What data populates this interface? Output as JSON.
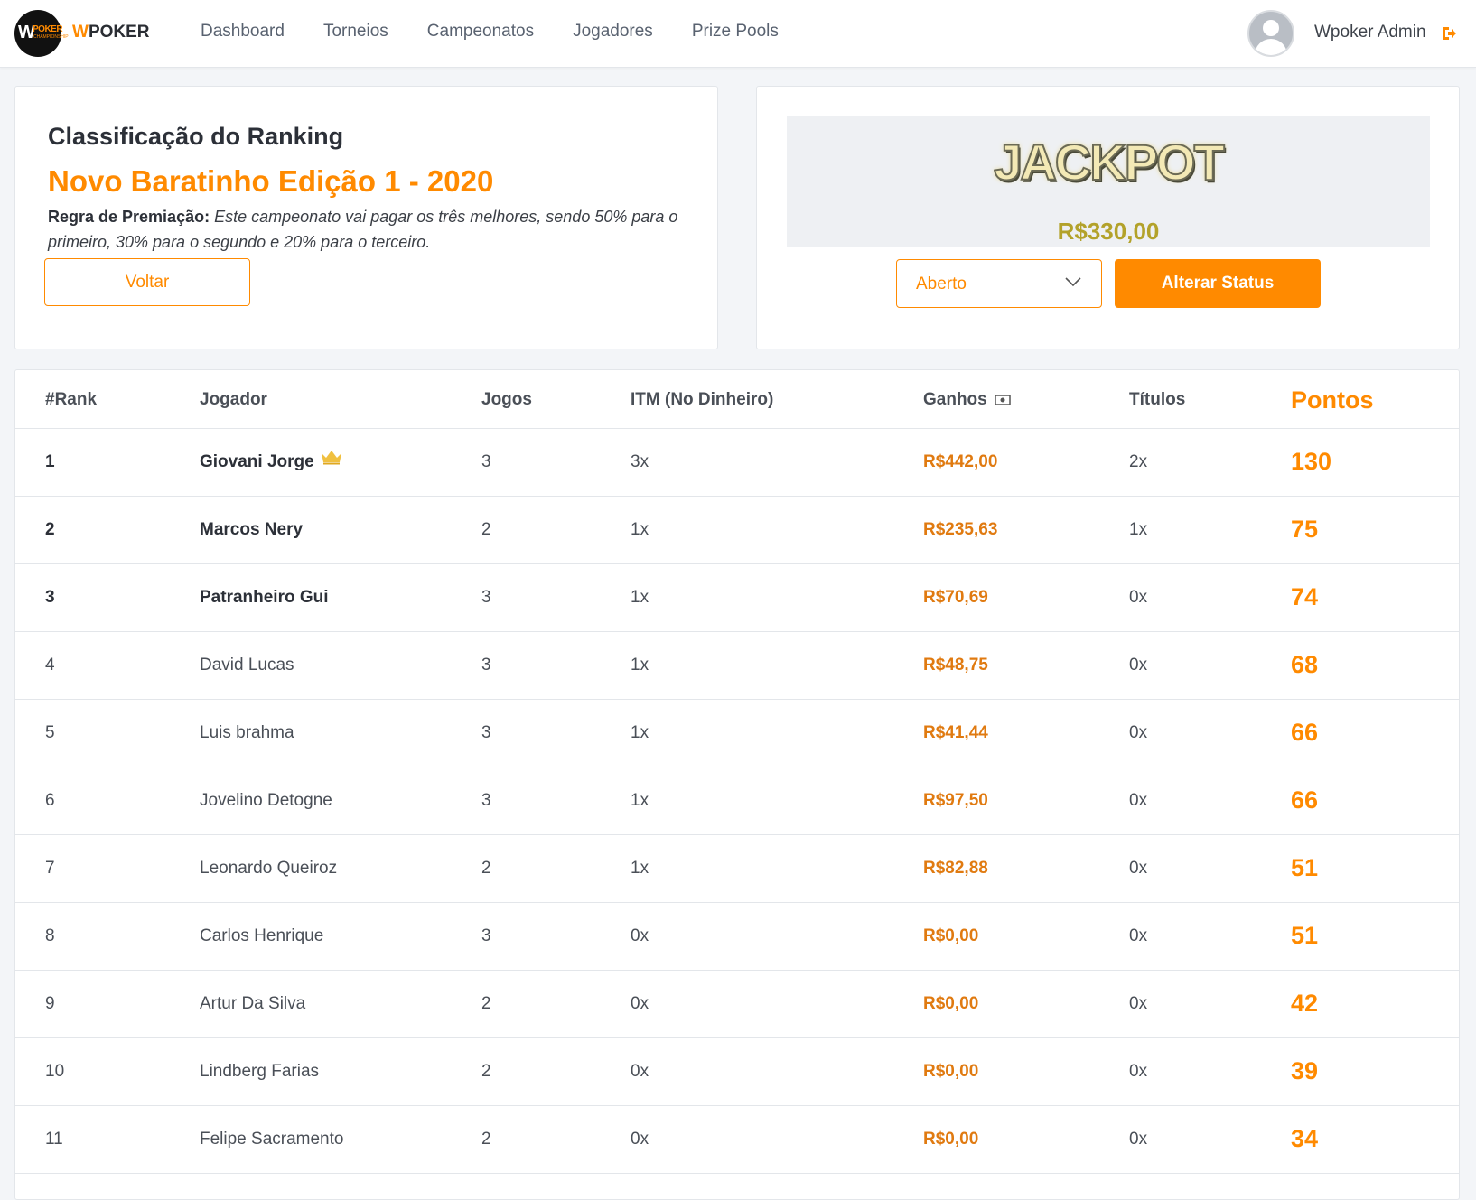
{
  "navbar": {
    "brand_prefix": "W",
    "brand_rest": "POKER",
    "logo_w": "W",
    "logo_poker": "POKER",
    "logo_sub": "CHAMPIONSHIP",
    "links": [
      "Dashboard",
      "Torneios",
      "Campeonatos",
      "Jogadores",
      "Prize Pools"
    ],
    "user_name": "Wpoker Admin",
    "accent_color": "#ff8a00"
  },
  "ranking": {
    "heading": "Classificação do Ranking",
    "title": "Novo Baratinho Edição 1 - 2020",
    "rule_label": "Regra de Premiação:",
    "rule_text": "Este campeonato vai pagar os três melhores, sendo 50% para o primeiro, 30% para o segundo e 20% para o terceiro.",
    "back_button": "Voltar"
  },
  "jackpot": {
    "word": "JACKPOT",
    "value": "R$330,00",
    "status_selected": "Aberto",
    "status_button": "Alterar Status"
  },
  "table": {
    "headers": {
      "rank": "#Rank",
      "player": "Jogador",
      "games": "Jogos",
      "itm": "ITM (No Dinheiro)",
      "money": "Ganhos",
      "titles": "Títulos",
      "points": "Pontos"
    },
    "rows": [
      {
        "rank": "1",
        "player": "Giovani Jorge",
        "games": "3",
        "itm": "3x",
        "money": "R$442,00",
        "titles": "2x",
        "points": "130",
        "top": true,
        "crown": true
      },
      {
        "rank": "2",
        "player": "Marcos Nery",
        "games": "2",
        "itm": "1x",
        "money": "R$235,63",
        "titles": "1x",
        "points": "75",
        "top": true,
        "crown": false
      },
      {
        "rank": "3",
        "player": "Patranheiro Gui",
        "games": "3",
        "itm": "1x",
        "money": "R$70,69",
        "titles": "0x",
        "points": "74",
        "top": true,
        "crown": false
      },
      {
        "rank": "4",
        "player": "David Lucas",
        "games": "3",
        "itm": "1x",
        "money": "R$48,75",
        "titles": "0x",
        "points": "68",
        "top": false,
        "crown": false
      },
      {
        "rank": "5",
        "player": "Luis brahma",
        "games": "3",
        "itm": "1x",
        "money": "R$41,44",
        "titles": "0x",
        "points": "66",
        "top": false,
        "crown": false
      },
      {
        "rank": "6",
        "player": "Jovelino Detogne",
        "games": "3",
        "itm": "1x",
        "money": "R$97,50",
        "titles": "0x",
        "points": "66",
        "top": false,
        "crown": false
      },
      {
        "rank": "7",
        "player": "Leonardo Queiroz",
        "games": "2",
        "itm": "1x",
        "money": "R$82,88",
        "titles": "0x",
        "points": "51",
        "top": false,
        "crown": false
      },
      {
        "rank": "8",
        "player": "Carlos Henrique",
        "games": "3",
        "itm": "0x",
        "money": "R$0,00",
        "titles": "0x",
        "points": "51",
        "top": false,
        "crown": false
      },
      {
        "rank": "9",
        "player": "Artur Da Silva",
        "games": "2",
        "itm": "0x",
        "money": "R$0,00",
        "titles": "0x",
        "points": "42",
        "top": false,
        "crown": false
      },
      {
        "rank": "10",
        "player": "Lindberg Farias",
        "games": "2",
        "itm": "0x",
        "money": "R$0,00",
        "titles": "0x",
        "points": "39",
        "top": false,
        "crown": false
      },
      {
        "rank": "11",
        "player": "Felipe Sacramento",
        "games": "2",
        "itm": "0x",
        "money": "R$0,00",
        "titles": "0x",
        "points": "34",
        "top": false,
        "crown": false
      }
    ]
  }
}
